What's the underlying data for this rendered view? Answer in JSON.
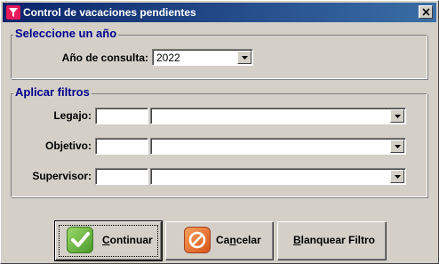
{
  "window": {
    "title": "Control de vacaciones pendientes",
    "close_label": "Close",
    "accent": "#0a246a",
    "icon": "funnel-icon"
  },
  "year_group": {
    "legend": "Seleccione un año",
    "year_label": "Año de consulta:",
    "year_value": "2022"
  },
  "filters_group": {
    "legend": "Aplicar filtros",
    "rows": [
      {
        "label": "Legajo:",
        "code_value": "",
        "name_value": ""
      },
      {
        "label": "Objetivo:",
        "code_value": "",
        "name_value": ""
      },
      {
        "label": "Supervisor:",
        "code_value": "",
        "name_value": ""
      }
    ]
  },
  "buttons": {
    "continue": {
      "label_first": "C",
      "label_rest": "ontinuar",
      "icon": "checkmark-icon"
    },
    "cancel": {
      "label_pre": "Ca",
      "label_u": "n",
      "label_rest": "celar",
      "icon": "cancel-circle-icon"
    },
    "clear": {
      "label_first": "B",
      "label_rest": "lanquear Filtro"
    }
  }
}
